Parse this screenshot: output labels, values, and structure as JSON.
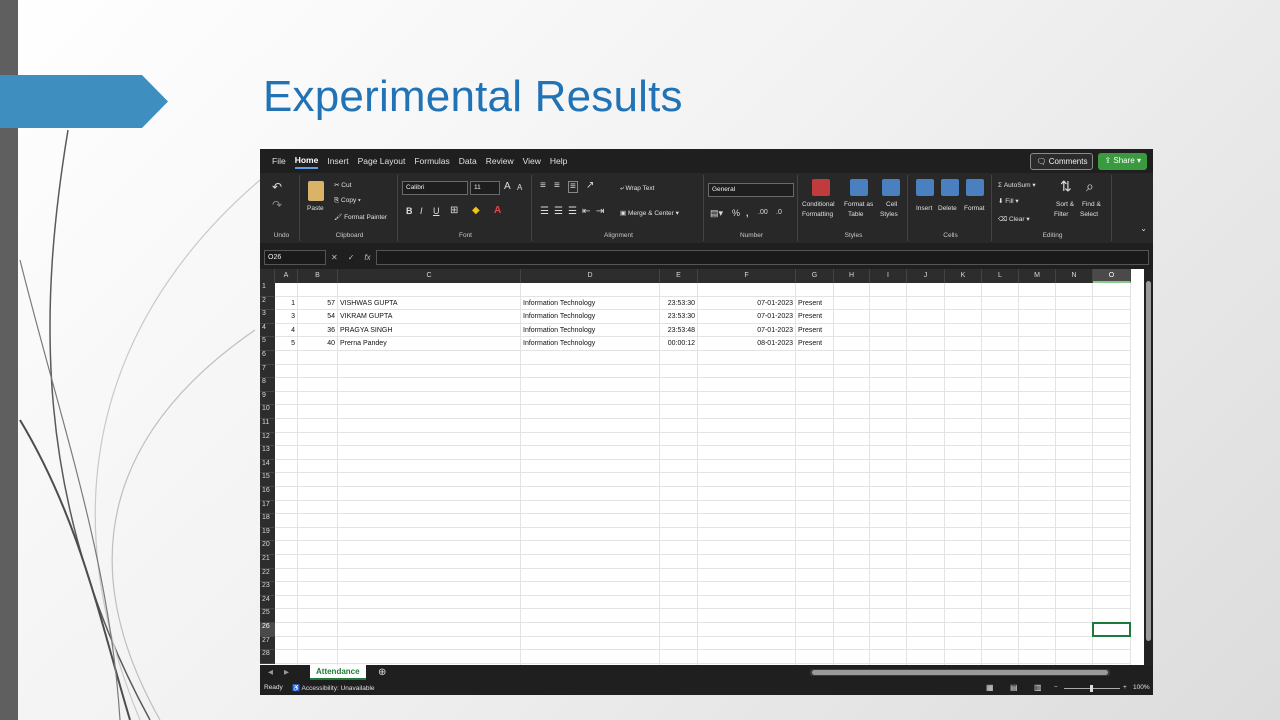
{
  "slide": {
    "title": "Experimental Results"
  },
  "excel": {
    "menu": [
      "File",
      "Home",
      "Insert",
      "Page Layout",
      "Formulas",
      "Data",
      "Review",
      "View",
      "Help"
    ],
    "active_menu": "Home",
    "comments_label": "Comments",
    "share_label": "Share",
    "ribbon": {
      "undo_label": "Undo",
      "clipboard": {
        "paste": "Paste",
        "cut": "Cut",
        "copy": "Copy",
        "format_painter": "Format Painter",
        "label": "Clipboard"
      },
      "font": {
        "name": "Calibri",
        "size": "11",
        "label": "Font"
      },
      "alignment": {
        "wrap_text": "Wrap Text",
        "merge_center": "Merge & Center",
        "label": "Alignment"
      },
      "number": {
        "format": "General",
        "label": "Number"
      },
      "styles": {
        "conditional": "Conditional",
        "conditional2": "Formatting",
        "format_as": "Format as",
        "format_as2": "Table",
        "cell": "Cell",
        "cell2": "Styles",
        "label": "Styles"
      },
      "cells": {
        "insert": "Insert",
        "delete": "Delete",
        "format": "Format",
        "label": "Cells"
      },
      "editing": {
        "autosum": "AutoSum",
        "fill": "Fill",
        "clear": "Clear",
        "sort": "Sort &",
        "sort2": "Filter",
        "find": "Find &",
        "find2": "Select",
        "label": "Editing"
      }
    },
    "name_box": "O26",
    "columns": [
      "A",
      "B",
      "C",
      "D",
      "E",
      "F",
      "G",
      "H",
      "I",
      "J",
      "K",
      "L",
      "M",
      "N",
      "O"
    ],
    "selected_column": "O",
    "selected_row": "26",
    "rows": [
      {
        "a": "1",
        "b": "57",
        "c": "VISHWAS GUPTA",
        "d": "Information Technology",
        "e": "23:53:30",
        "f": "07-01-2023",
        "g": "Present"
      },
      {
        "a": "3",
        "b": "54",
        "c": "VIKRAM GUPTA",
        "d": "Information Technology",
        "e": "23:53:30",
        "f": "07-01-2023",
        "g": "Present"
      },
      {
        "a": "4",
        "b": "36",
        "c": "PRAGYA SINGH",
        "d": "Information Technology",
        "e": "23:53:48",
        "f": "07-01-2023",
        "g": "Present"
      },
      {
        "a": "5",
        "b": "40",
        "c": "Prerna Pandey",
        "d": "Information Technology",
        "e": "00:00:12",
        "f": "08-01-2023",
        "g": "Present"
      }
    ],
    "row_numbers": [
      "1",
      "2",
      "3",
      "4",
      "5",
      "6",
      "7",
      "8",
      "9",
      "10",
      "11",
      "12",
      "13",
      "14",
      "15",
      "16",
      "17",
      "18",
      "19",
      "20",
      "21",
      "22",
      "23",
      "24",
      "25",
      "26",
      "27",
      "28"
    ],
    "sheet_tab": "Attendance",
    "status": {
      "ready": "Ready",
      "accessibility": "Accessibility: Unavailable",
      "zoom": "100%"
    }
  }
}
